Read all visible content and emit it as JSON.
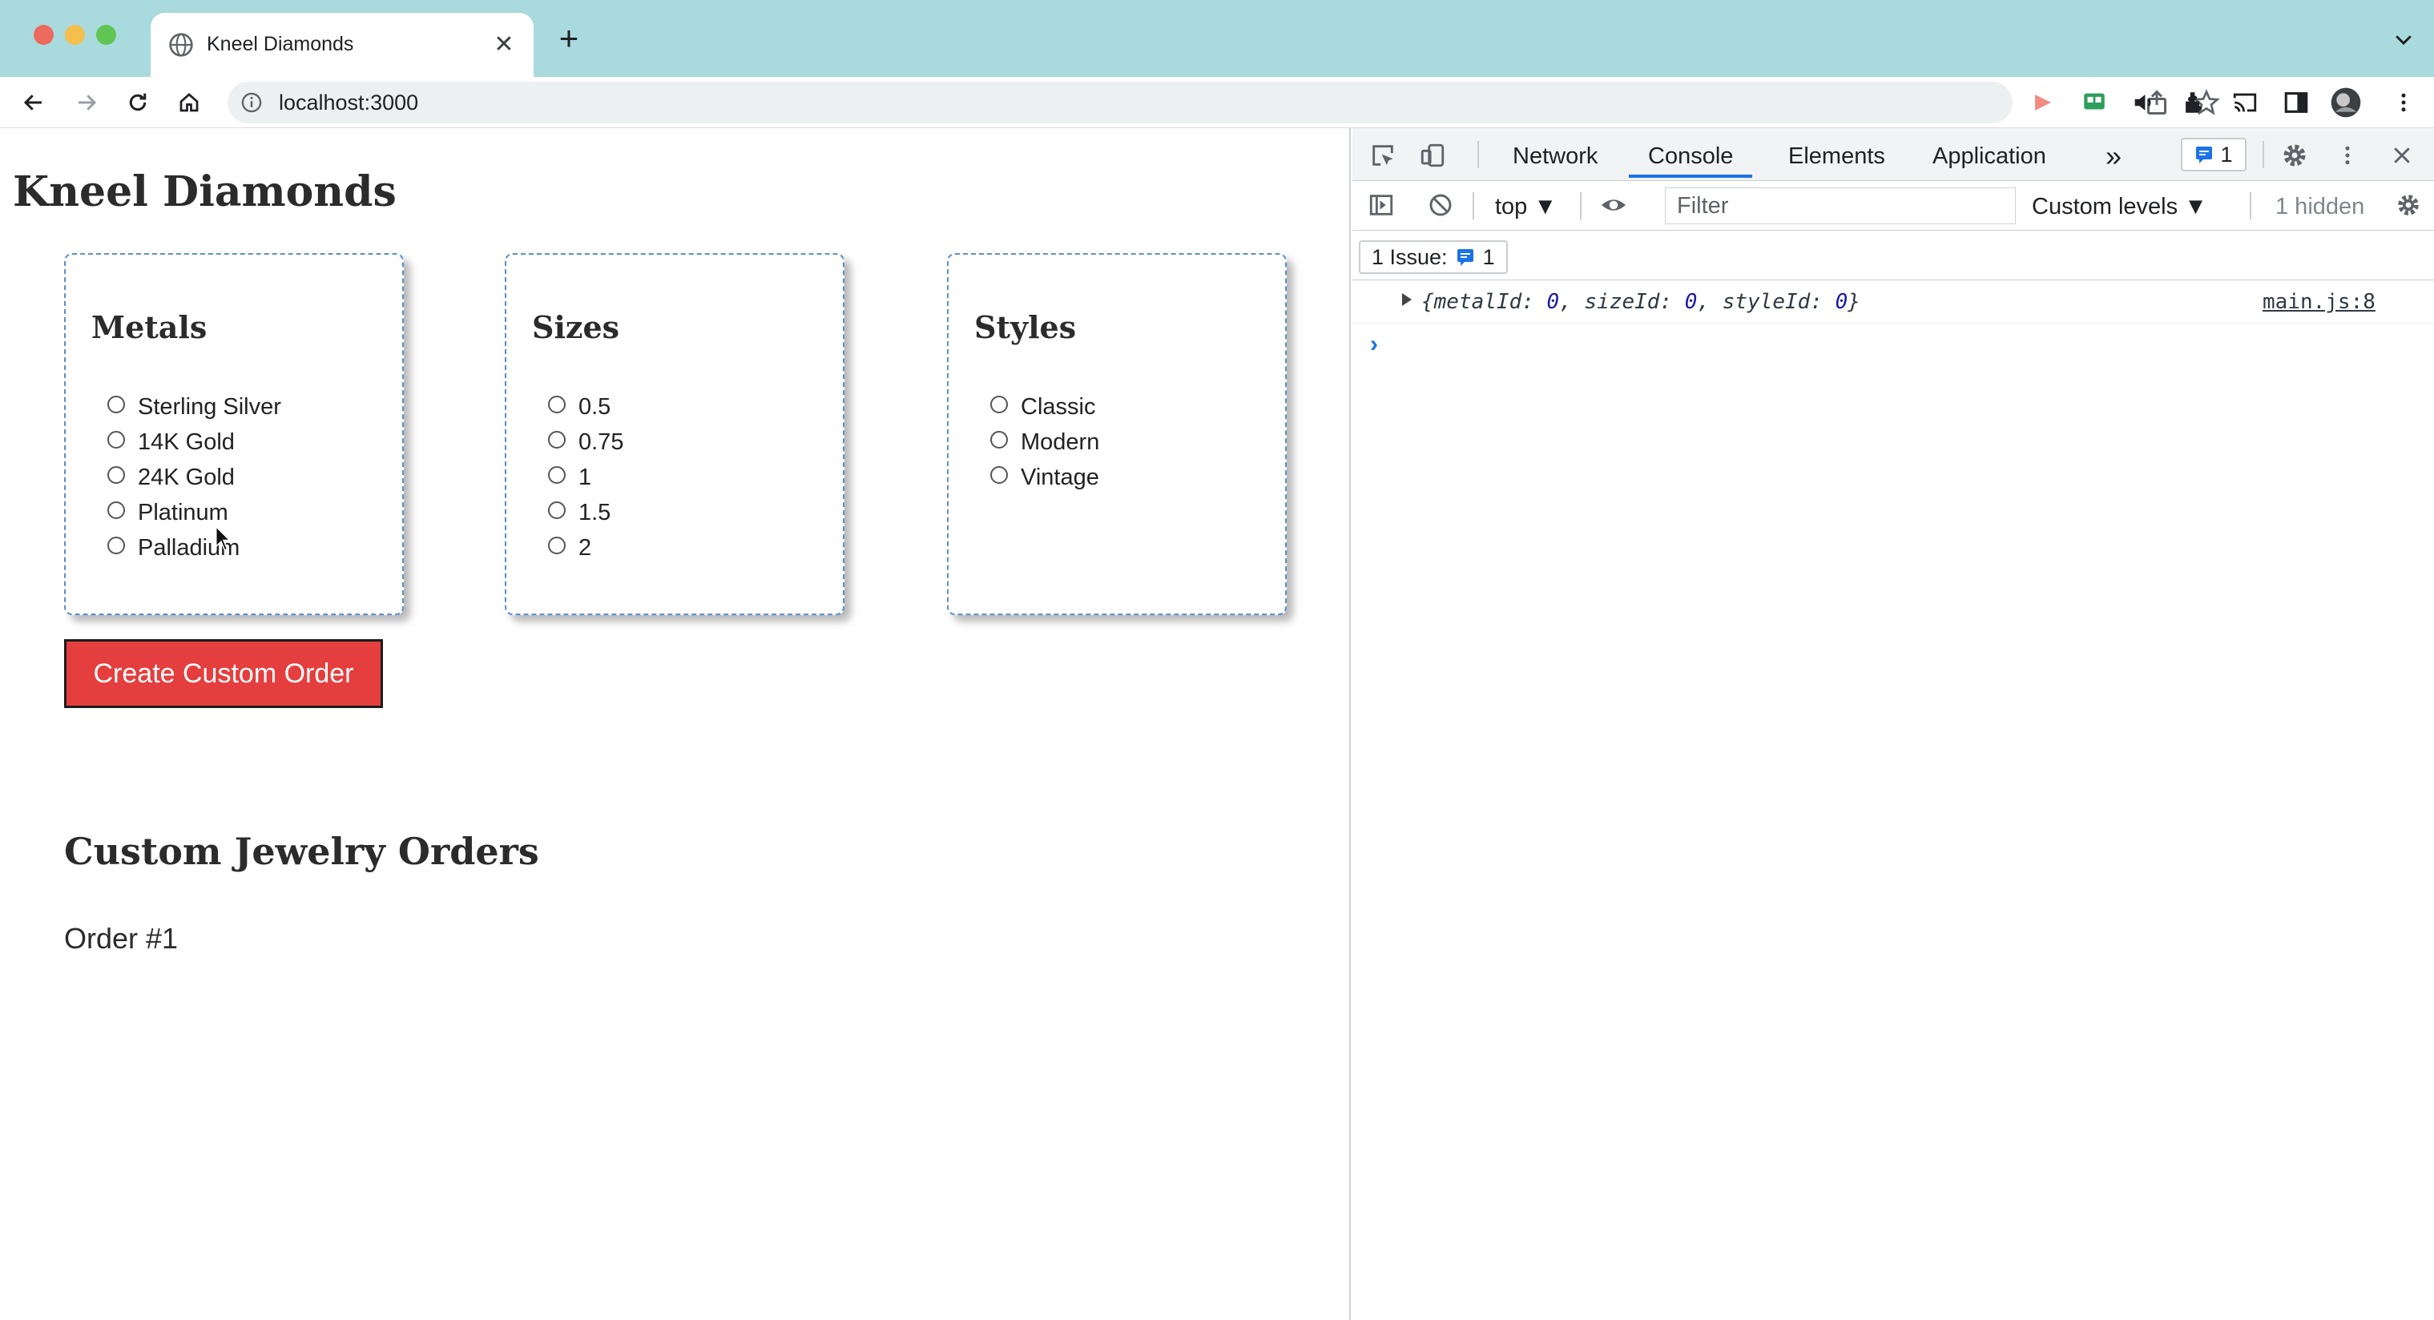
{
  "browser": {
    "tab_title": "Kneel Diamonds",
    "new_tab_label": "+",
    "tab_close_label": "✕",
    "url": "localhost:3000"
  },
  "page": {
    "title": "Kneel Diamonds",
    "cards": [
      {
        "heading": "Metals",
        "options": [
          "Sterling Silver",
          "14K Gold",
          "24K Gold",
          "Platinum",
          "Palladium"
        ]
      },
      {
        "heading": "Sizes",
        "options": [
          "0.5",
          "0.75",
          "1",
          "1.5",
          "2"
        ]
      },
      {
        "heading": "Styles",
        "options": [
          "Classic",
          "Modern",
          "Vintage"
        ]
      }
    ],
    "create_button_label": "Create Custom Order",
    "orders_heading": "Custom Jewelry Orders",
    "orders": [
      "Order #1"
    ]
  },
  "devtools": {
    "tabs": [
      "Network",
      "Console",
      "Elements",
      "Application"
    ],
    "active_tab": "Console",
    "more_tabs_label": "»",
    "issue_badge_count": "1",
    "context": "top ▼",
    "filter_placeholder": "Filter",
    "levels_label": "Custom levels ▼",
    "hidden_label": "1 hidden",
    "issues_label": "1 Issue:",
    "issues_count": "1",
    "console_log": {
      "open_brace": "{",
      "k1": "metalId: ",
      "v1": "0",
      "k2": "sizeId: ",
      "v2": "0",
      "k3": "styleId: ",
      "v3": "0",
      "close_brace": "}",
      "source": "main.js:8"
    },
    "prompt_symbol": "›"
  },
  "colors": {
    "tabbar": "#a9dadd",
    "create_button": "#e53e3e",
    "card_border": "#5b8fd0",
    "devtools_accent": "#1a73e8"
  }
}
